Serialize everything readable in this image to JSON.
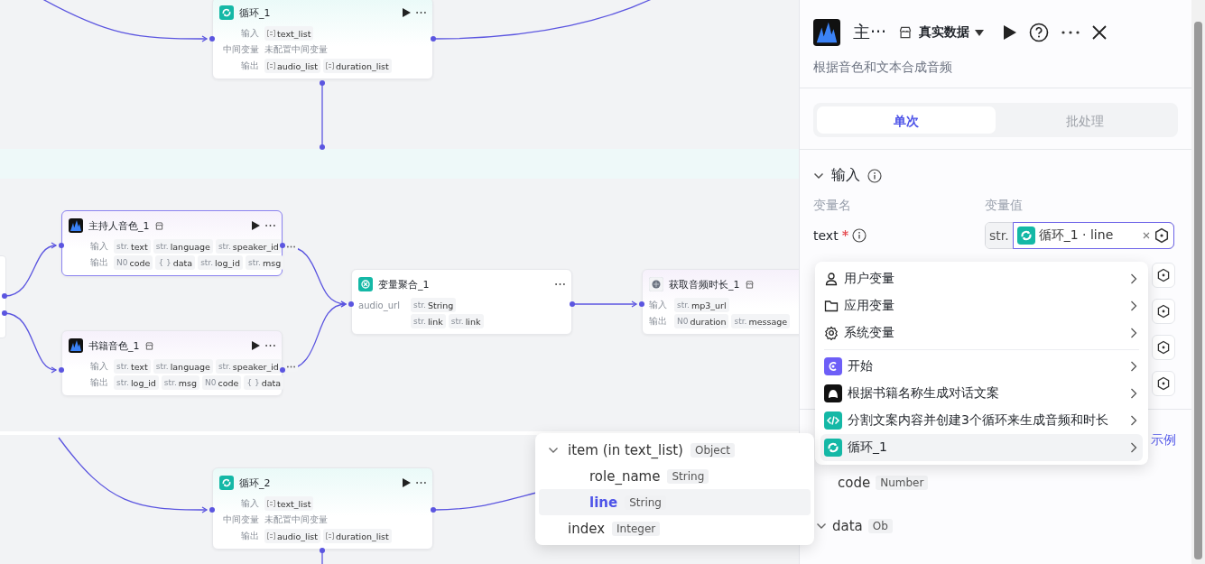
{
  "canvas": {
    "nodes": [
      {
        "title": "循环_1",
        "kind": "loop",
        "selected": false,
        "runnable": true,
        "store": false,
        "rows": [
          {
            "label": "输入",
            "tags": [
              {
                "kind": "array",
                "name": "text_list"
              }
            ]
          },
          {
            "label": "中间变量",
            "note": "未配置中间变量"
          },
          {
            "label": "输出",
            "tags": [
              {
                "kind": "array",
                "name": "audio_list"
              },
              {
                "kind": "array",
                "name": "duration_list"
              }
            ]
          }
        ]
      },
      {
        "title": "主持人音色_1",
        "kind": "voice",
        "selected": true,
        "runnable": true,
        "store": true,
        "rows": [
          {
            "label": "输入",
            "overflow": true,
            "tags": [
              {
                "kind": "typed",
                "prefix": "str.",
                "name": "text"
              },
              {
                "kind": "typed",
                "prefix": "str.",
                "name": "language"
              },
              {
                "kind": "typed",
                "prefix": "str.",
                "name": "speaker_id"
              }
            ]
          },
          {
            "label": "输出",
            "tags": [
              {
                "kind": "typed",
                "prefix": "N0",
                "name": "code"
              },
              {
                "kind": "typed",
                "prefix": "{ }",
                "name": "data"
              },
              {
                "kind": "typed",
                "prefix": "str.",
                "name": "log_id"
              },
              {
                "kind": "typed",
                "prefix": "str.",
                "name": "msg"
              }
            ]
          }
        ]
      },
      {
        "title": "书籍音色_1",
        "kind": "voice",
        "selected": false,
        "runnable": true,
        "store": true,
        "rows": [
          {
            "label": "输入",
            "overflow": true,
            "tags": [
              {
                "kind": "typed",
                "prefix": "str.",
                "name": "text"
              },
              {
                "kind": "typed",
                "prefix": "str.",
                "name": "language"
              },
              {
                "kind": "typed",
                "prefix": "str.",
                "name": "speaker_id"
              }
            ]
          },
          {
            "label": "输出",
            "tags": [
              {
                "kind": "typed",
                "prefix": "str.",
                "name": "log_id"
              },
              {
                "kind": "typed",
                "prefix": "str.",
                "name": "msg"
              },
              {
                "kind": "typed",
                "prefix": "N0",
                "name": "code"
              },
              {
                "kind": "typed",
                "prefix": "{ }",
                "name": "data"
              }
            ]
          }
        ]
      },
      {
        "title": "变量聚合_1",
        "kind": "aggregate",
        "selected": false,
        "runnable": false,
        "store": false,
        "rows": [
          {
            "label": "audio_url",
            "tags": [
              {
                "kind": "typed",
                "prefix": "str.",
                "name": "String"
              }
            ]
          },
          {
            "tags": [
              {
                "kind": "typed",
                "prefix": "str.",
                "name": "link"
              },
              {
                "kind": "typed",
                "prefix": "str.",
                "name": "link"
              }
            ]
          }
        ]
      },
      {
        "title": "获取音频时长_1",
        "kind": "plugin",
        "selected": false,
        "runnable": false,
        "store": true,
        "rows": [
          {
            "label": "输入",
            "tags": [
              {
                "kind": "typed",
                "prefix": "str.",
                "name": "mp3_url"
              }
            ]
          },
          {
            "label": "输出",
            "tags": [
              {
                "kind": "typed",
                "prefix": "N0",
                "name": "duration"
              },
              {
                "kind": "typed",
                "prefix": "str.",
                "name": "message"
              }
            ]
          }
        ]
      },
      {
        "title": "循环_2",
        "kind": "loop",
        "selected": false,
        "runnable": true,
        "store": false,
        "rows": [
          {
            "label": "输入",
            "tags": [
              {
                "kind": "array",
                "name": "text_list"
              }
            ]
          },
          {
            "label": "中间变量",
            "note": "未配置中间变量"
          },
          {
            "label": "输出",
            "tags": [
              {
                "kind": "array",
                "name": "audio_list"
              },
              {
                "kind": "array",
                "name": "duration_list"
              }
            ]
          }
        ]
      }
    ]
  },
  "tree_popup": {
    "items": [
      {
        "name": "item (in text_list)",
        "type": "Object",
        "expanded": true,
        "selected": false,
        "children": [
          {
            "name": "role_name",
            "type": "String",
            "selected": false
          },
          {
            "name": "line",
            "type": "String",
            "selected": true
          }
        ]
      },
      {
        "name": "index",
        "type": "Integer",
        "selected": false
      }
    ]
  },
  "panel": {
    "title": "主···",
    "data_mode": "真实数据",
    "description": "根据音色和文本合成音频",
    "tabs": [
      {
        "label": "单次",
        "selected": true
      },
      {
        "label": "批处理",
        "selected": false
      }
    ],
    "input_section": {
      "title": "输入",
      "expanded": true,
      "col_name": "变量名",
      "col_value": "变量值",
      "params": [
        {
          "name": "text",
          "required": true,
          "type": "str.",
          "ref_node": "循环_1 · line"
        }
      ]
    },
    "example_link": "示例",
    "outputs": [
      {
        "name": "code",
        "type": "Number",
        "expandable": false
      },
      {
        "name": "data",
        "type": "Ob",
        "expandable": true
      }
    ]
  },
  "var_menu": {
    "variable_items": [
      {
        "label": "用户变量",
        "kind": "user",
        "selected": false
      },
      {
        "label": "应用变量",
        "kind": "folder",
        "selected": false
      },
      {
        "label": "系统变量",
        "kind": "gear",
        "selected": false
      }
    ],
    "node_items": [
      {
        "label": "开始",
        "kind": "start",
        "selected": false
      },
      {
        "label": "根据书籍名称生成对话文案",
        "kind": "bot",
        "selected": false
      },
      {
        "label": "分割文案内容并创建3个循环来生成音频和时长",
        "kind": "code",
        "selected": false
      },
      {
        "label": "循环_1",
        "kind": "loop",
        "selected": true
      }
    ]
  }
}
